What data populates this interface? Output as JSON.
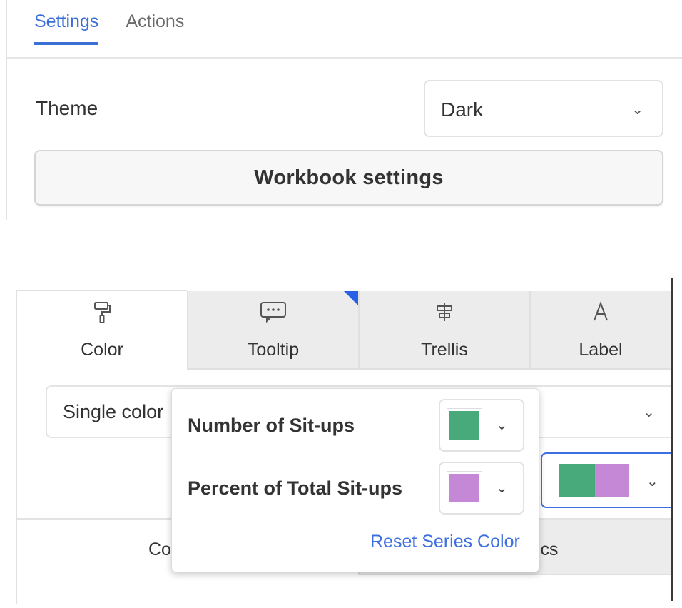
{
  "settings_panel": {
    "tabs": [
      {
        "label": "Settings",
        "active": true
      },
      {
        "label": "Actions",
        "active": false
      }
    ],
    "theme": {
      "label": "Theme",
      "selected": "Dark"
    },
    "workbook_button": "Workbook settings"
  },
  "format_panel": {
    "tabs": [
      {
        "label": "Color",
        "icon": "paint-roller-icon",
        "active": true
      },
      {
        "label": "Tooltip",
        "icon": "tooltip-icon",
        "active": false
      },
      {
        "label": "Trellis",
        "icon": "trellis-icon",
        "active": false
      },
      {
        "label": "Label",
        "icon": "label-icon",
        "active": false
      }
    ],
    "color_mode": "Single color",
    "color_swatches": [
      "#48a97a",
      "#c588d6"
    ],
    "sub_tabs": [
      "Co",
      "ics"
    ],
    "popover": {
      "series": [
        {
          "name": "Number of Sit-ups",
          "color": "#48a97a"
        },
        {
          "name": "Percent of Total Sit-ups",
          "color": "#c588d6"
        }
      ],
      "reset_label": "Reset Series Color"
    }
  },
  "colors": {
    "accent": "#3b6fd8",
    "corner_marker": "#2762e6"
  }
}
